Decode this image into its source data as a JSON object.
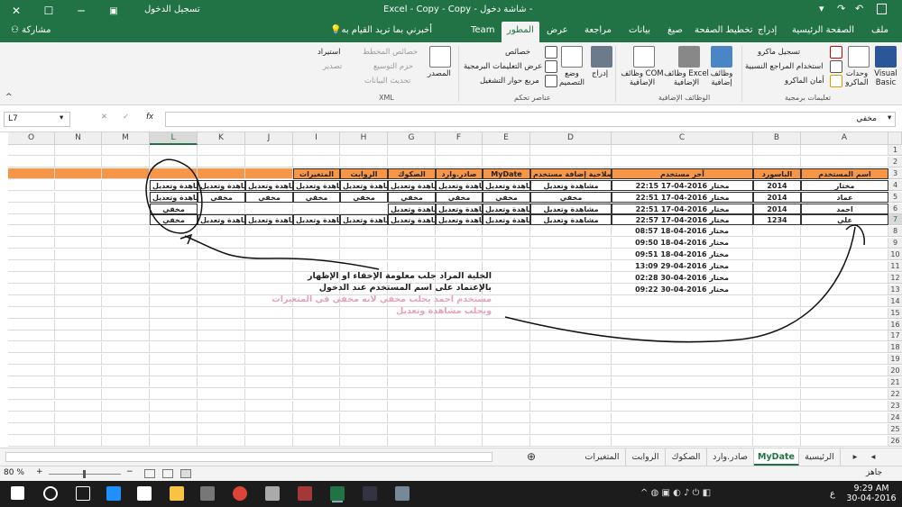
{
  "window": {
    "title": "Excel - Copy - Copy - شاشة دخول -",
    "signin": "تسجيل الدخول",
    "controls": [
      "✕",
      "☐",
      "─"
    ]
  },
  "ribbon_tabs": [
    "ملف",
    "الصفحة الرئيسية",
    "إدراج",
    "تخطيط الصفحة",
    "صيغ",
    "بيانات",
    "مراجعة",
    "عرض",
    "المطور",
    "Team"
  ],
  "active_tab": "المطور",
  "tellme": "أخبرني بما تريد القيام به",
  "share": "مشاركة",
  "ribbon": {
    "code": {
      "visual_basic": "Visual Basic",
      "macros": "وحدات الماكرو",
      "record": "تسجيل ماكرو",
      "relative": "استخدام المراجع النسبية",
      "security": "أمان الماكرو",
      "label": "تعليمات برمجية"
    },
    "addins": {
      "addins": "وظائف إضافية",
      "excel_addins": "وظائف Excel الإضافية",
      "com_addins": "وظائف COM الإضافية",
      "label": "الوظائف الإضافية"
    },
    "controls": {
      "insert": "إدراج",
      "design": "وضع التصميم",
      "properties": "خصائص",
      "view_code": "عرض التعليمات البرمجية",
      "dialog": "مربع حوار التشغيل",
      "label": "عناصر تحكم"
    },
    "xml": {
      "source": "المصدر",
      "map_props": "خصائص المخطط",
      "packs": "حزم التوسيع",
      "refresh": "تحديث البيانات",
      "import": "استيراد",
      "export": "تصدير",
      "label": "XML"
    }
  },
  "namebox": "L7",
  "formula": "مخفي",
  "columns": [
    "A",
    "B",
    "C",
    "D",
    "E",
    "F",
    "G",
    "H",
    "I",
    "J",
    "K",
    "L",
    "M",
    "N",
    "O"
  ],
  "header_row": [
    "اسم المستخدم",
    "الباسورد",
    "آخر مستخدم",
    "صلاحية إضافة مستخدم",
    "MyDate",
    "صادر.وارد",
    "الصكوك",
    "الروابت",
    "المتغيرات",
    "",
    "",
    "",
    "",
    "",
    ""
  ],
  "data_rows": [
    [
      "مختار",
      "2014",
      "مختار  2016-04-17  22:15",
      "مشاهدة وتعديل",
      "مشاهدة وتعديل",
      "مشاهدة وتعديل",
      "مشاهدة وتعديل",
      "مشاهدة وتعديل",
      "مشاهدة وتعديل",
      "مشاهدة وتعديل",
      "مشاهدة وتعديل",
      "مشاهدة وتعديل",
      "",
      "",
      ""
    ],
    [
      "عماد",
      "2014",
      "مختار  2016-04-17  22:51",
      "مخفي",
      "مخفي",
      "مخفي",
      "مخفي",
      "مخفي",
      "مخفي",
      "مخفي",
      "مخفي",
      "مشاهدة وتعديل",
      "",
      "",
      ""
    ],
    [
      "احمد",
      "2014",
      "مختار  2016-04-17  22:51",
      "مشاهدة وتعديل",
      "مشاهدة وتعديل",
      "مشاهدة وتعديل",
      "مشاهدة وتعديل",
      "",
      "",
      "",
      "",
      "مخفي",
      "",
      "",
      ""
    ],
    [
      "علي",
      "1234",
      "مختار  2016-04-17  22:57",
      "مشاهدة وتعديل",
      "مشاهدة وتعديل",
      "مشاهدة وتعديل",
      "مشاهدة وتعديل",
      "مشاهدة وتعديل",
      "مشاهدة وتعديل",
      "مشاهدة وتعديل",
      "مشاهدة وتعديل",
      "مخفي",
      "",
      "",
      ""
    ],
    [
      "",
      "",
      "مختار  2016-04-18  08:57",
      "",
      "",
      "",
      "",
      "",
      "",
      "",
      "",
      "",
      "",
      "",
      ""
    ],
    [
      "",
      "",
      "مختار  2016-04-18  09:50",
      "",
      "",
      "",
      "",
      "",
      "",
      "",
      "",
      "",
      "",
      "",
      ""
    ],
    [
      "",
      "",
      "مختار  2016-04-18  09:51",
      "",
      "",
      "",
      "",
      "",
      "",
      "",
      "",
      "",
      "",
      "",
      ""
    ],
    [
      "",
      "",
      "مختار  2016-04-29  13:09",
      "",
      "",
      "",
      "",
      "",
      "",
      "",
      "",
      "",
      "",
      "",
      ""
    ],
    [
      "",
      "",
      "مختار  2016-04-30  02:28",
      "",
      "",
      "",
      "",
      "",
      "",
      "",
      "",
      "",
      "",
      "",
      ""
    ],
    [
      "",
      "",
      "مختار  2016-04-30  09:22",
      "",
      "",
      "",
      "",
      "",
      "",
      "",
      "",
      "",
      "",
      "",
      ""
    ]
  ],
  "annotation": {
    "line1": "الخلية المراد جلب معلومة الإخفاء او الإظهار",
    "line2": "بالإعتماد على اسم المستخدم عند الدخول",
    "line3": "مستخدم احمد يجلب مخفي لانه مخفي في المتغيرات",
    "line4": "ويجلب مشاهدة وتعديل"
  },
  "sheets": [
    "الرئيسية",
    "MyDate",
    "صادر.وارد",
    "الصكوك",
    "الروابت",
    "المتغيرات"
  ],
  "active_sheet": "MyDate",
  "status": {
    "ready": "جاهز",
    "zoom": "80 %"
  },
  "taskbar": {
    "time": "9:29 AM",
    "date": "30-04-2016",
    "lang": "ع"
  },
  "colors": {
    "excel_green": "#217346",
    "header_fill": "#f79646"
  }
}
